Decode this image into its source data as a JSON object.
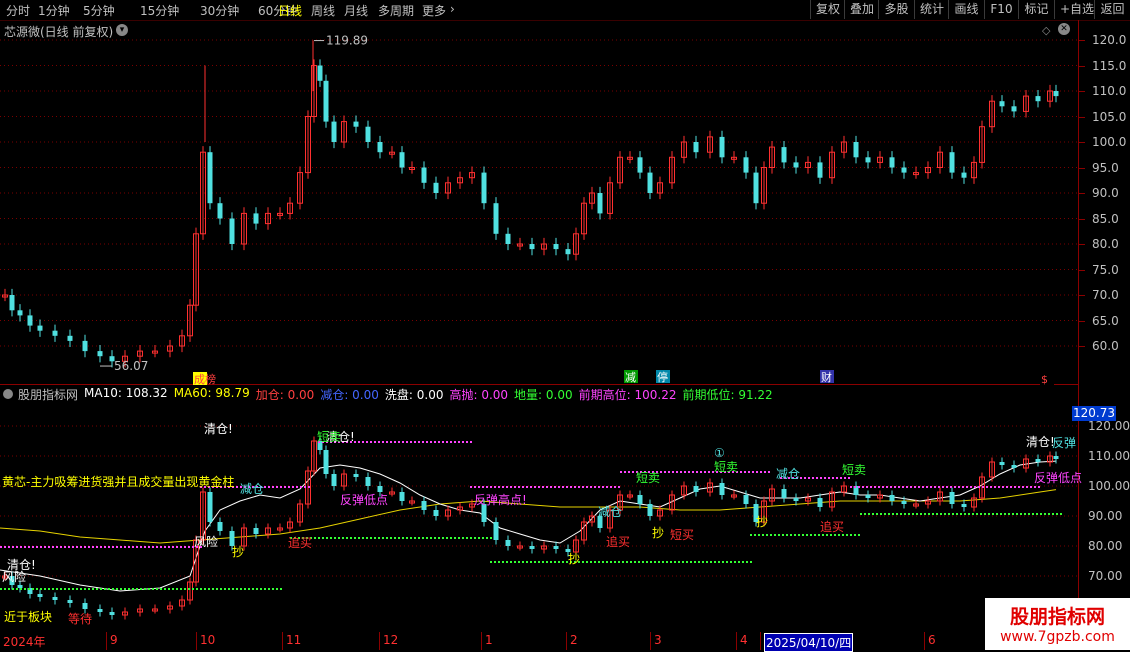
{
  "toolbar": {
    "periods": [
      "分时",
      "1分钟",
      "5分钟",
      "15分钟",
      "30分钟",
      "60分钟",
      "日线",
      "周线",
      "月线",
      "多周期",
      "更多"
    ],
    "active": "日线",
    "more_chevron": "›",
    "buttons": [
      "复权",
      "叠加",
      "多股",
      "统计",
      "画线",
      "F10",
      "标记",
      "+自选",
      "返回"
    ]
  },
  "stock": {
    "title": "芯源微(日线 前复权)",
    "collapse_icon": "chevron-down-icon"
  },
  "main_chart": {
    "price_axis": [
      "120.0",
      "115.0",
      "110.0",
      "105.0",
      "100.0",
      "95.0",
      "90.0",
      "85.0",
      "80.0",
      "75.0",
      "70.0",
      "65.0",
      "60.0"
    ],
    "high_label": "119.89",
    "low_label": "56.07",
    "event_marks": [
      {
        "text": "成榜",
        "color": "#ff4040",
        "bg": "#ffff00"
      },
      {
        "text": "减",
        "color": "#ffffff",
        "bg": "#009900"
      },
      {
        "text": "停",
        "color": "#ffffff",
        "bg": "#0088aa"
      },
      {
        "text": "财",
        "color": "#ffffff",
        "bg": "#3333aa"
      },
      {
        "text": "$",
        "color": "#ff4040",
        "bg": "#000"
      }
    ]
  },
  "indicator": {
    "name": "股朋指标网",
    "items": [
      {
        "label": "MA10:",
        "value": "108.32",
        "color": "#ffffff"
      },
      {
        "label": "MA60:",
        "value": "98.79",
        "color": "#ffff00"
      },
      {
        "label": "加仓:",
        "value": "0.00",
        "color": "#ff4040"
      },
      {
        "label": "减仓:",
        "value": "0.00",
        "color": "#4466ff"
      },
      {
        "label": "洗盘:",
        "value": "0.00",
        "color": "#ffffff"
      },
      {
        "label": "高抛:",
        "value": "0.00",
        "color": "#ff44ff"
      },
      {
        "label": "地量:",
        "value": "0.00",
        "color": "#33ff33"
      },
      {
        "label": "前期高位:",
        "value": "100.22",
        "color": "#ff44ff"
      },
      {
        "label": "前期低位:",
        "value": "91.22",
        "color": "#33ff33"
      }
    ],
    "axis": [
      "120.00",
      "110.00",
      "100.00",
      "90.00",
      "80.00",
      "70.00"
    ],
    "current": "120.73",
    "labels": {
      "clear1": "清仓!",
      "clear2": "清仓!",
      "clear3": "清仓!",
      "clear4": "清仓!",
      "risk1": "风险",
      "risk2": "风险",
      "reduce1": "减仓",
      "reduce2": "减仓",
      "reduce3": "减仓",
      "chase1": "追买",
      "chase2": "追买",
      "chase3": "追买",
      "short1": "短卖",
      "short2": "短卖",
      "short3": "短卖",
      "short4": "短卖",
      "short5": "短买",
      "rebound_low": "反弹低点",
      "rebound_high": "反弹高点!",
      "rebound": "反弹",
      "rebound_low2": "反弹低点",
      "buy1": "抄",
      "buy2": "抄",
      "buy3": "抄",
      "buy4": "抄",
      "gold_text": "黄芯-主力吸筹进货强并且成交量出现黄金柱",
      "sector": "近于板块",
      "wait": "等待",
      "circle": "①"
    }
  },
  "dates": [
    "2024年",
    "9",
    "10",
    "11",
    "12",
    "1",
    "2",
    "3",
    "4",
    "2025/04/10/四",
    "6"
  ],
  "watermark": {
    "title": "股朋指标网",
    "url": "www.7gpzb.com"
  }
}
